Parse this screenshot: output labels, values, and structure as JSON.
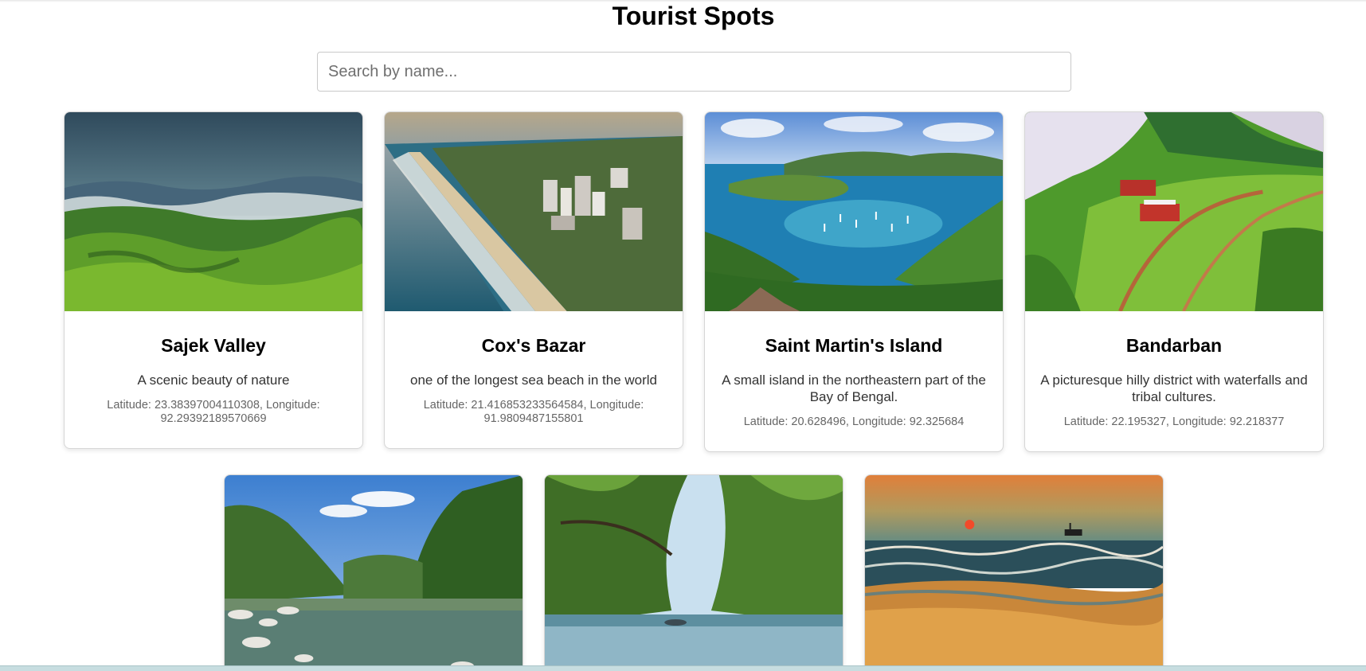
{
  "page": {
    "title": "Tourist Spots"
  },
  "search": {
    "placeholder": "Search by name...",
    "value": ""
  },
  "spots": [
    {
      "name": "Sajek Valley",
      "description": "A scenic beauty of nature",
      "coords": "Latitude: 23.38397004110308, Longitude: 92.29392189570669",
      "image": "green-hills-fog"
    },
    {
      "name": "Cox's Bazar",
      "description": "one of the longest sea beach in the world",
      "coords": "Latitude: 21.416853233564584, Longitude: 91.9809487155801",
      "image": "aerial-beach-city"
    },
    {
      "name": "Saint Martin's Island",
      "description": "A small island in the northeastern part of the Bay of Bengal.",
      "coords": "Latitude: 20.628496, Longitude: 92.325684",
      "image": "bay-with-boats"
    },
    {
      "name": "Bandarban",
      "description": "A picturesque hilly district with waterfalls and tribal cultures.",
      "coords": "Latitude: 22.195327, Longitude: 92.218377",
      "image": "hilltop-houses"
    },
    {
      "image": "river-gorge"
    },
    {
      "image": "mangrove-river-boat"
    },
    {
      "image": "sunset-beach-ship"
    }
  ],
  "colors": {
    "card_border": "#d6d6d6",
    "coords_text": "#666666",
    "desc_text": "#333333"
  }
}
